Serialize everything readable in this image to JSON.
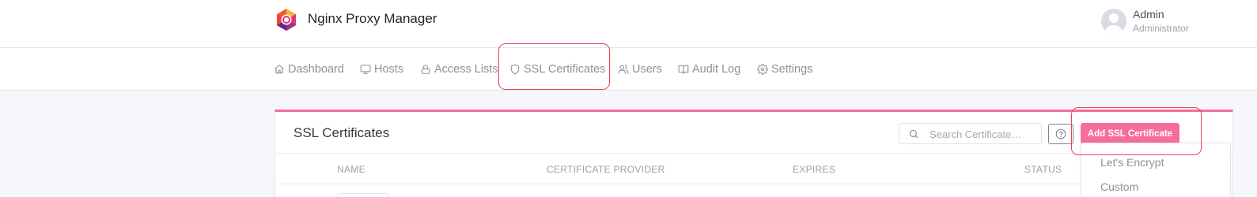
{
  "header": {
    "app_title": "Nginx Proxy Manager",
    "user": {
      "name": "Admin",
      "role": "Administrator"
    }
  },
  "nav": {
    "items": [
      {
        "label": "Dashboard",
        "icon": "home-icon"
      },
      {
        "label": "Hosts",
        "icon": "monitor-icon"
      },
      {
        "label": "Access Lists",
        "icon": "lock-icon"
      },
      {
        "label": "SSL Certificates",
        "icon": "shield-icon",
        "active": true
      },
      {
        "label": "Users",
        "icon": "users-icon"
      },
      {
        "label": "Audit Log",
        "icon": "book-open-icon"
      },
      {
        "label": "Settings",
        "icon": "gear-icon"
      }
    ]
  },
  "main": {
    "card_title": "SSL Certificates",
    "search": {
      "placeholder": "Search Certificate…"
    },
    "add_button_label": "Add SSL Certificate",
    "table": {
      "columns": [
        "NAME",
        "CERTIFICATE PROVIDER",
        "EXPIRES",
        "STATUS"
      ]
    },
    "dropdown": {
      "items": [
        "Let's Encrypt",
        "Custom"
      ]
    }
  },
  "colors": {
    "accent": "#f66d9b",
    "highlight": "#e8434f"
  }
}
